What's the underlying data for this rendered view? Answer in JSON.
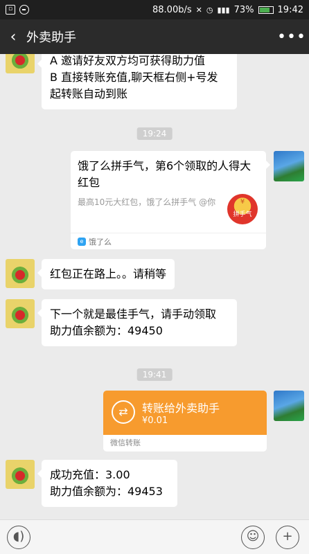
{
  "status_bar": {
    "left_icons": [
      "notification-icon",
      "minus-circle-icon"
    ],
    "net_speed": "88.00b/s",
    "battery": "73%",
    "battery_level": 0.73,
    "time": "19:42"
  },
  "header": {
    "title": "外卖助手",
    "back_icon": "back-arrow-icon",
    "more_icon": "more-icon"
  },
  "messages": {
    "m0_line1": "A 邀请好友双方均可获得助力值",
    "m0_line2": "B 直接转账充值,聊天框右侧+号发",
    "m0_line3": "起转账自动到账",
    "t1": "19:24",
    "card": {
      "title": "饿了么拼手气，第6个领取的人得大红包",
      "desc": "最高10元大红包，饿了么拼手气 @你",
      "icon_text": "拼手气",
      "icon_symbol": "¥",
      "source_logo": "e",
      "source": "饿了么"
    },
    "m1": "红包正在路上。。请稍等",
    "m2_line1": "下一个就是最佳手气，请手动领取",
    "m2_line2": "助力值余额为：49450",
    "t2": "19:41",
    "transfer": {
      "title": "转账给外卖助手",
      "amount": "¥0.01",
      "footer": "微信转账",
      "icon_symbol": "⇄"
    },
    "m3_line1": "成功充值：3.00",
    "m3_line2": "助力值余额为：49453"
  },
  "input_bar": {
    "voice_icon": "voice-icon",
    "emoji_icon": "emoji-icon",
    "plus_icon": "plus-icon"
  }
}
